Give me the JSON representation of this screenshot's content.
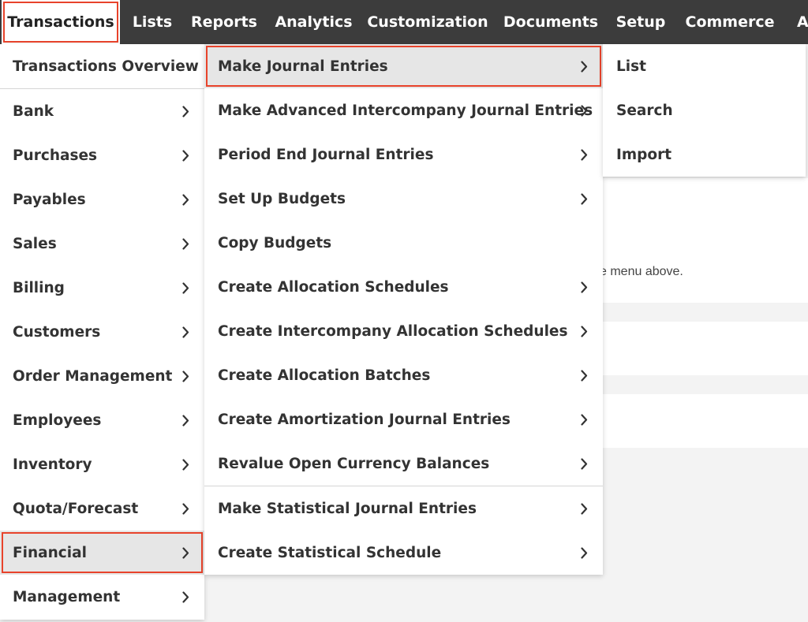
{
  "navbar": {
    "items": [
      {
        "label": "Transactions",
        "active": true
      },
      {
        "label": "Lists"
      },
      {
        "label": "Reports"
      },
      {
        "label": "Analytics"
      },
      {
        "label": "Customization"
      },
      {
        "label": "Documents"
      },
      {
        "label": "Setup"
      },
      {
        "label": "Commerce"
      },
      {
        "label": "A"
      }
    ]
  },
  "page": {
    "partial_text": "e menu above."
  },
  "menu_transactions": {
    "overview": "Transactions Overview",
    "items": [
      {
        "label": "Bank"
      },
      {
        "label": "Purchases"
      },
      {
        "label": "Payables"
      },
      {
        "label": "Sales"
      },
      {
        "label": "Billing"
      },
      {
        "label": "Customers"
      },
      {
        "label": "Order Management"
      },
      {
        "label": "Employees"
      },
      {
        "label": "Inventory"
      },
      {
        "label": "Quota/Forecast"
      },
      {
        "label": "Financial",
        "selected": true
      },
      {
        "label": "Management"
      }
    ]
  },
  "menu_financial": {
    "items": [
      {
        "label": "Make Journal Entries",
        "selected": true
      },
      {
        "label": "Make Advanced Intercompany Journal Entries"
      },
      {
        "label": "Period End Journal Entries"
      },
      {
        "label": "Set Up Budgets"
      },
      {
        "label": "Copy Budgets"
      },
      {
        "label": "Create Allocation Schedules"
      },
      {
        "label": "Create Intercompany Allocation Schedules"
      },
      {
        "label": "Create Allocation Batches"
      },
      {
        "label": "Create Amortization Journal Entries"
      },
      {
        "label": "Revalue Open Currency Balances"
      },
      {
        "label": "Make Statistical Journal Entries"
      },
      {
        "label": "Create Statistical Schedule"
      }
    ]
  },
  "menu_journal": {
    "items": [
      {
        "label": "List"
      },
      {
        "label": "Search"
      },
      {
        "label": "Import"
      }
    ]
  },
  "colors": {
    "navbar_bg": "#3c3c3c",
    "highlight_border": "#e8432b",
    "highlight_bg": "#e6e6e6",
    "text": "#333333"
  },
  "icons": {
    "submenu": "chevron-right-icon"
  }
}
